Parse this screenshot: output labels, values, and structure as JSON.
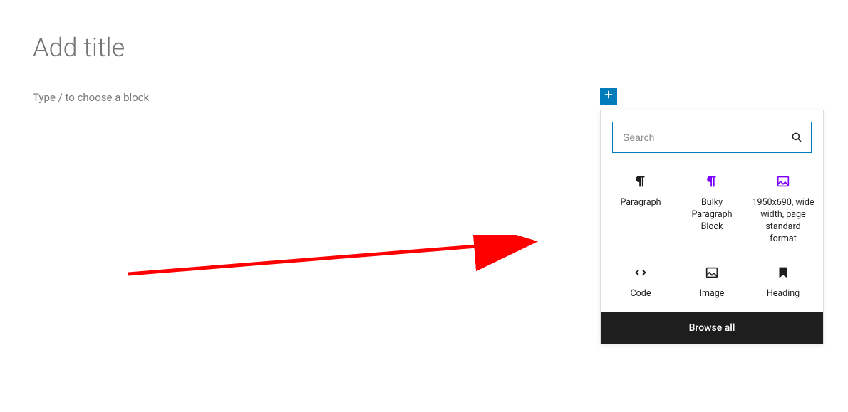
{
  "editor": {
    "title_placeholder": "Add title",
    "block_hint": "Type / to choose a block"
  },
  "inserter": {
    "search_placeholder": "Search",
    "browse_all": "Browse all",
    "blocks": [
      {
        "label": "Paragraph",
        "icon": "pilcrow",
        "color": "#1e1e1e"
      },
      {
        "label": "Bulky Paragraph Block",
        "icon": "pilcrow",
        "color": "#7b00ff"
      },
      {
        "label": "1950x690, wide width, page standard format",
        "icon": "image",
        "color": "#7b00ff"
      },
      {
        "label": "Code",
        "icon": "code",
        "color": "#1e1e1e"
      },
      {
        "label": "Image",
        "icon": "image",
        "color": "#1e1e1e"
      },
      {
        "label": "Heading",
        "icon": "bookmark",
        "color": "#1e1e1e"
      }
    ]
  }
}
